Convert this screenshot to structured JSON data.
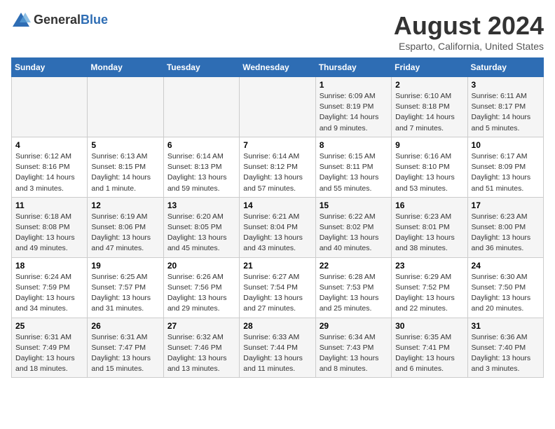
{
  "logo": {
    "general": "General",
    "blue": "Blue"
  },
  "title": "August 2024",
  "subtitle": "Esparto, California, United States",
  "days_of_week": [
    "Sunday",
    "Monday",
    "Tuesday",
    "Wednesday",
    "Thursday",
    "Friday",
    "Saturday"
  ],
  "weeks": [
    [
      {
        "day": "",
        "info": ""
      },
      {
        "day": "",
        "info": ""
      },
      {
        "day": "",
        "info": ""
      },
      {
        "day": "",
        "info": ""
      },
      {
        "day": "1",
        "info": "Sunrise: 6:09 AM\nSunset: 8:19 PM\nDaylight: 14 hours\nand 9 minutes."
      },
      {
        "day": "2",
        "info": "Sunrise: 6:10 AM\nSunset: 8:18 PM\nDaylight: 14 hours\nand 7 minutes."
      },
      {
        "day": "3",
        "info": "Sunrise: 6:11 AM\nSunset: 8:17 PM\nDaylight: 14 hours\nand 5 minutes."
      }
    ],
    [
      {
        "day": "4",
        "info": "Sunrise: 6:12 AM\nSunset: 8:16 PM\nDaylight: 14 hours\nand 3 minutes."
      },
      {
        "day": "5",
        "info": "Sunrise: 6:13 AM\nSunset: 8:15 PM\nDaylight: 14 hours\nand 1 minute."
      },
      {
        "day": "6",
        "info": "Sunrise: 6:14 AM\nSunset: 8:13 PM\nDaylight: 13 hours\nand 59 minutes."
      },
      {
        "day": "7",
        "info": "Sunrise: 6:14 AM\nSunset: 8:12 PM\nDaylight: 13 hours\nand 57 minutes."
      },
      {
        "day": "8",
        "info": "Sunrise: 6:15 AM\nSunset: 8:11 PM\nDaylight: 13 hours\nand 55 minutes."
      },
      {
        "day": "9",
        "info": "Sunrise: 6:16 AM\nSunset: 8:10 PM\nDaylight: 13 hours\nand 53 minutes."
      },
      {
        "day": "10",
        "info": "Sunrise: 6:17 AM\nSunset: 8:09 PM\nDaylight: 13 hours\nand 51 minutes."
      }
    ],
    [
      {
        "day": "11",
        "info": "Sunrise: 6:18 AM\nSunset: 8:08 PM\nDaylight: 13 hours\nand 49 minutes."
      },
      {
        "day": "12",
        "info": "Sunrise: 6:19 AM\nSunset: 8:06 PM\nDaylight: 13 hours\nand 47 minutes."
      },
      {
        "day": "13",
        "info": "Sunrise: 6:20 AM\nSunset: 8:05 PM\nDaylight: 13 hours\nand 45 minutes."
      },
      {
        "day": "14",
        "info": "Sunrise: 6:21 AM\nSunset: 8:04 PM\nDaylight: 13 hours\nand 43 minutes."
      },
      {
        "day": "15",
        "info": "Sunrise: 6:22 AM\nSunset: 8:02 PM\nDaylight: 13 hours\nand 40 minutes."
      },
      {
        "day": "16",
        "info": "Sunrise: 6:23 AM\nSunset: 8:01 PM\nDaylight: 13 hours\nand 38 minutes."
      },
      {
        "day": "17",
        "info": "Sunrise: 6:23 AM\nSunset: 8:00 PM\nDaylight: 13 hours\nand 36 minutes."
      }
    ],
    [
      {
        "day": "18",
        "info": "Sunrise: 6:24 AM\nSunset: 7:59 PM\nDaylight: 13 hours\nand 34 minutes."
      },
      {
        "day": "19",
        "info": "Sunrise: 6:25 AM\nSunset: 7:57 PM\nDaylight: 13 hours\nand 31 minutes."
      },
      {
        "day": "20",
        "info": "Sunrise: 6:26 AM\nSunset: 7:56 PM\nDaylight: 13 hours\nand 29 minutes."
      },
      {
        "day": "21",
        "info": "Sunrise: 6:27 AM\nSunset: 7:54 PM\nDaylight: 13 hours\nand 27 minutes."
      },
      {
        "day": "22",
        "info": "Sunrise: 6:28 AM\nSunset: 7:53 PM\nDaylight: 13 hours\nand 25 minutes."
      },
      {
        "day": "23",
        "info": "Sunrise: 6:29 AM\nSunset: 7:52 PM\nDaylight: 13 hours\nand 22 minutes."
      },
      {
        "day": "24",
        "info": "Sunrise: 6:30 AM\nSunset: 7:50 PM\nDaylight: 13 hours\nand 20 minutes."
      }
    ],
    [
      {
        "day": "25",
        "info": "Sunrise: 6:31 AM\nSunset: 7:49 PM\nDaylight: 13 hours\nand 18 minutes."
      },
      {
        "day": "26",
        "info": "Sunrise: 6:31 AM\nSunset: 7:47 PM\nDaylight: 13 hours\nand 15 minutes."
      },
      {
        "day": "27",
        "info": "Sunrise: 6:32 AM\nSunset: 7:46 PM\nDaylight: 13 hours\nand 13 minutes."
      },
      {
        "day": "28",
        "info": "Sunrise: 6:33 AM\nSunset: 7:44 PM\nDaylight: 13 hours\nand 11 minutes."
      },
      {
        "day": "29",
        "info": "Sunrise: 6:34 AM\nSunset: 7:43 PM\nDaylight: 13 hours\nand 8 minutes."
      },
      {
        "day": "30",
        "info": "Sunrise: 6:35 AM\nSunset: 7:41 PM\nDaylight: 13 hours\nand 6 minutes."
      },
      {
        "day": "31",
        "info": "Sunrise: 6:36 AM\nSunset: 7:40 PM\nDaylight: 13 hours\nand 3 minutes."
      }
    ]
  ]
}
